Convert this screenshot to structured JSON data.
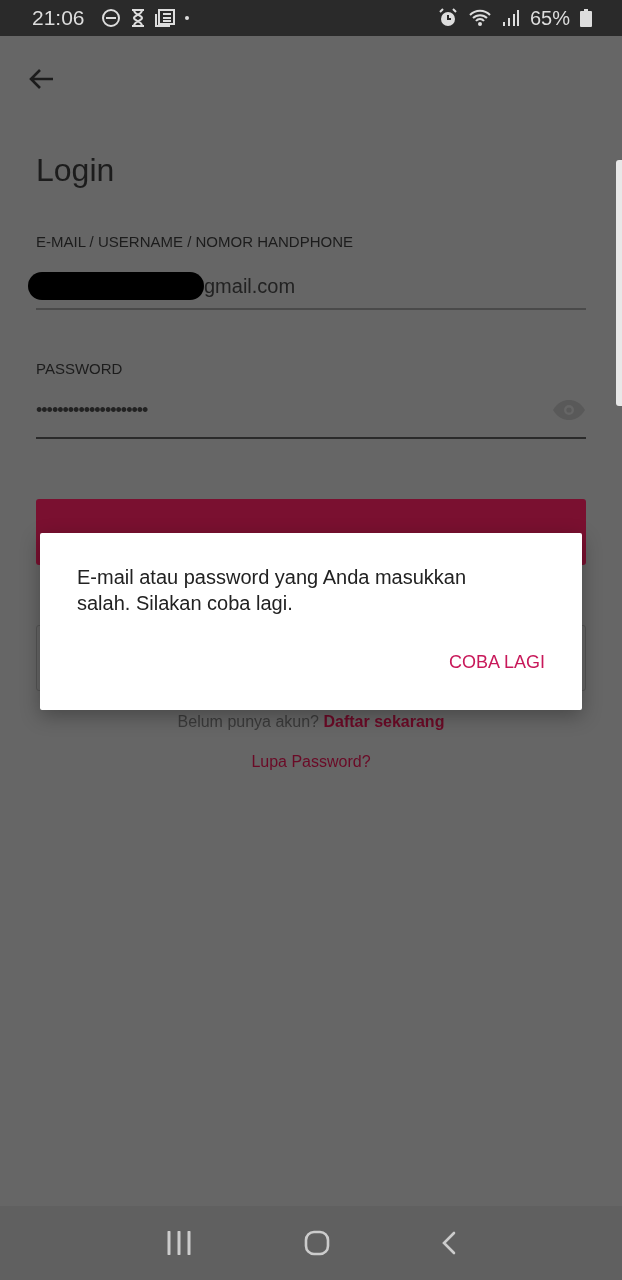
{
  "status_bar": {
    "time": "21:06",
    "battery": "65%"
  },
  "title": "Login",
  "fields": [
    {
      "kind": "text",
      "label": "E-MAIL / USERNAME / NOMOR HANDPHONE",
      "value": "gmail.com",
      "redacted": true
    },
    {
      "kind": "password",
      "label": "PASSWORD",
      "value": "•••••••••••••••••••••",
      "redacted": false
    }
  ],
  "signup": {
    "prompt": "Belum punya akun?",
    "link": "Daftar sekarang"
  },
  "forgot_link": "Lupa Password?",
  "dialog": {
    "message": "E-mail atau password yang Anda masukkan salah. Silakan coba lagi.",
    "action": "COBA LAGI"
  }
}
